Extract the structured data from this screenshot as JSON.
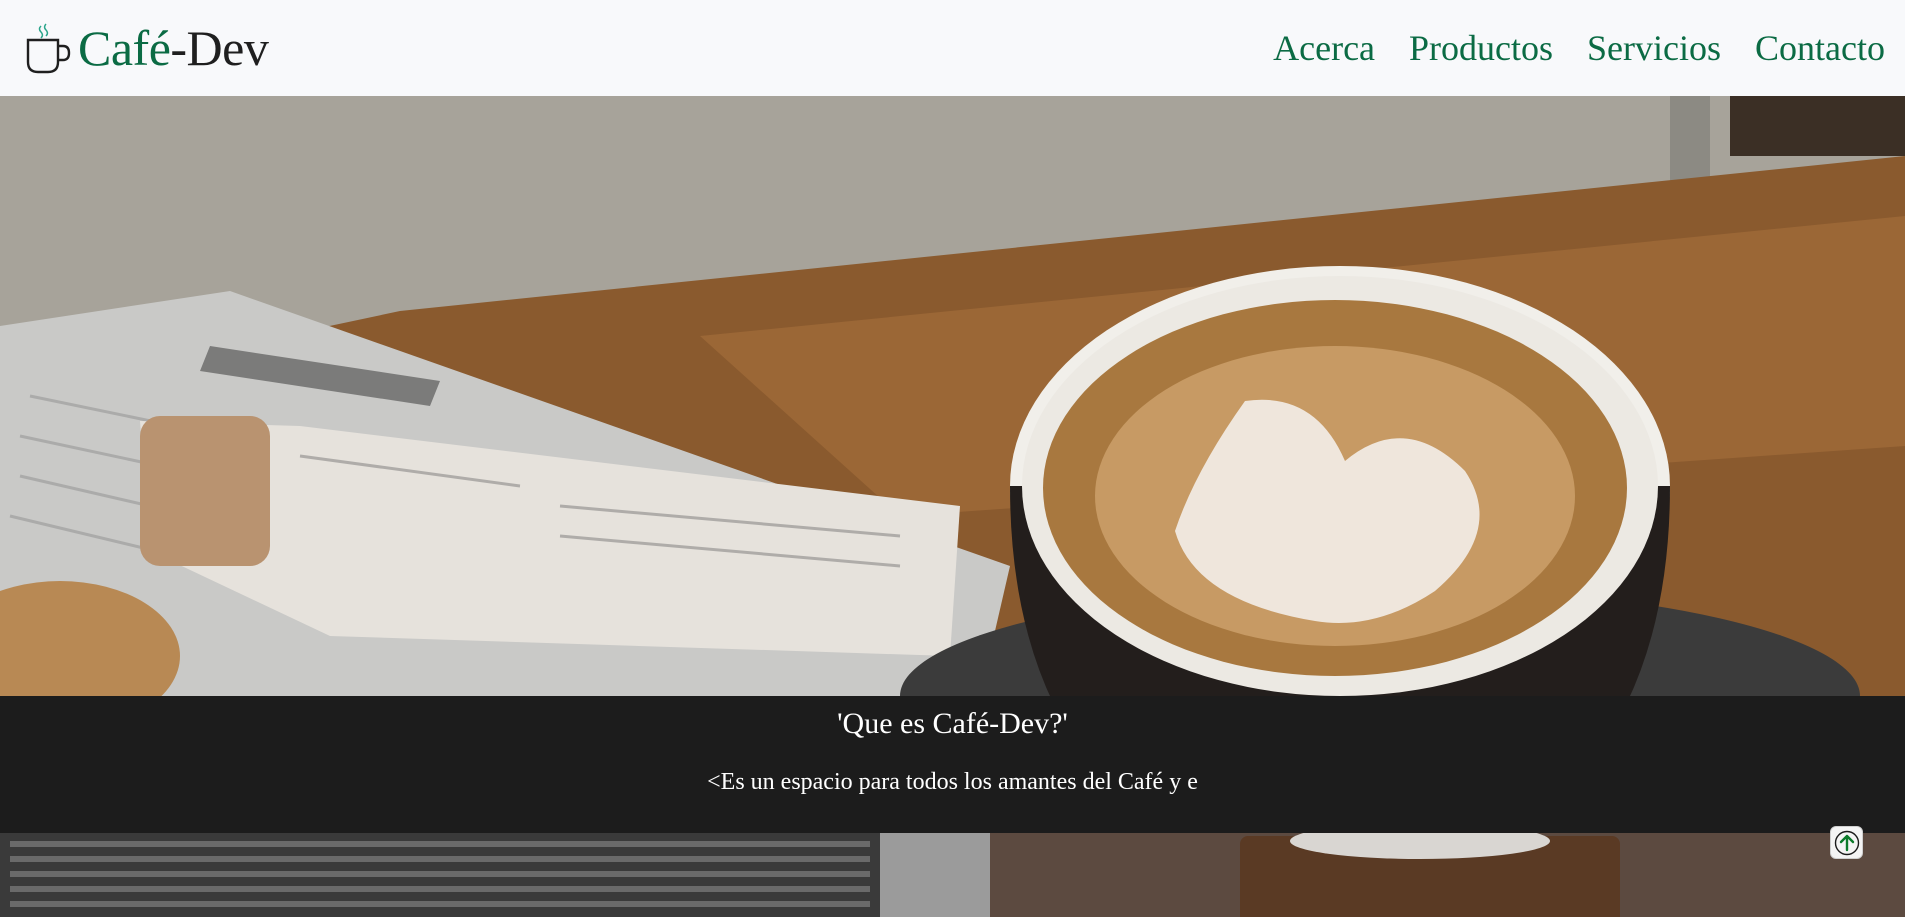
{
  "navbar": {
    "brand_part1": "Café",
    "brand_part2": "-Dev",
    "brand_icon": "coffee-cup-icon",
    "links": [
      {
        "label": "Acerca"
      },
      {
        "label": "Productos"
      },
      {
        "label": "Servicios"
      },
      {
        "label": "Contacto"
      }
    ]
  },
  "hero": {
    "image": "coffee-latte-photo"
  },
  "about": {
    "title": "'Que es Café-Dev?'",
    "text": "<Es un espacio para todos los amantes del Café y e"
  },
  "scroll_top": {
    "icon": "arrow-up-icon"
  },
  "colors": {
    "accent": "#0b6b44",
    "navbar_bg": "#f8f9fb",
    "section_bg": "#1c1c1c"
  }
}
